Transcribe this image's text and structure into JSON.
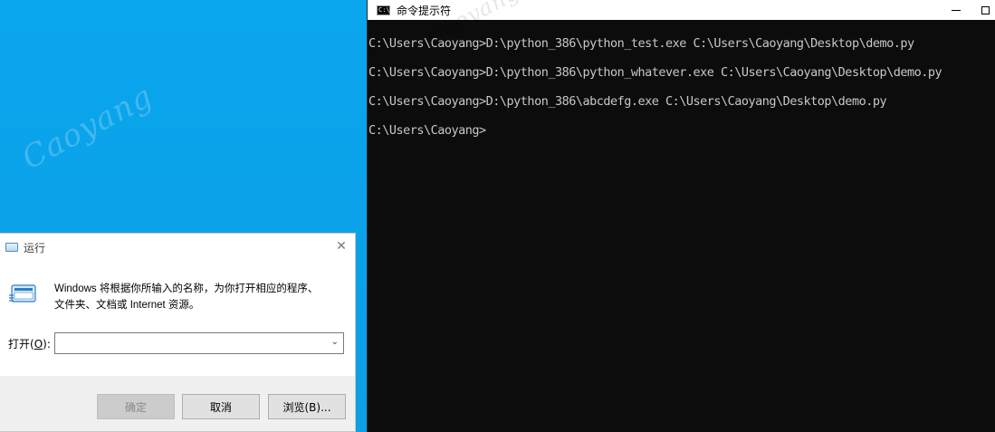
{
  "desktop": {
    "watermarks": [
      "Caoyang",
      "Caoyang"
    ],
    "colors": {
      "background": "#0ba3ea"
    }
  },
  "cmd": {
    "title": "命令提示符",
    "icon_text": "C:\\",
    "lines": [
      "C:\\Users\\Caoyang>D:\\python_386\\python_test.exe C:\\Users\\Caoyang\\Desktop\\demo.py",
      "C:\\Users\\Caoyang>D:\\python_386\\python_whatever.exe C:\\Users\\Caoyang\\Desktop\\demo.py",
      "C:\\Users\\Caoyang>D:\\python_386\\abcdefg.exe C:\\Users\\Caoyang\\Desktop\\demo.py",
      "C:\\Users\\Caoyang>"
    ],
    "title_watermark": "Caoyang"
  },
  "run_dialog": {
    "title": "运行",
    "description_line1": "Windows 将根据你所输入的名称，为你打开相应的程序、",
    "description_line2": "文件夹、文档或 Internet 资源。",
    "open_label_prefix": "打开(",
    "open_label_key": "O",
    "open_label_suffix": "):",
    "input_value": "",
    "buttons": {
      "ok": "确定",
      "cancel": "取消",
      "browse": "浏览(B)..."
    }
  }
}
